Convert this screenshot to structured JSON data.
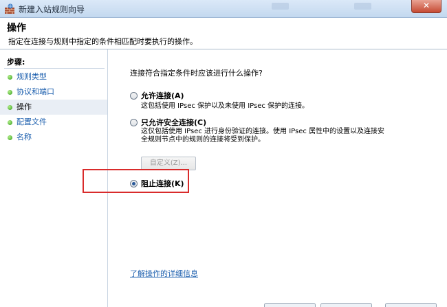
{
  "window": {
    "title": "新建入站规则向导",
    "close_glyph": "✕"
  },
  "header": {
    "title": "操作",
    "description": "指定在连接与规则中指定的条件相匹配时要执行的操作。"
  },
  "sidebar": {
    "steps_label": "步骤:",
    "items": [
      {
        "label": "规则类型",
        "active": false
      },
      {
        "label": "协议和端口",
        "active": false
      },
      {
        "label": "操作",
        "active": true
      },
      {
        "label": "配置文件",
        "active": false
      },
      {
        "label": "名称",
        "active": false
      }
    ]
  },
  "main": {
    "question": "连接符合指定条件时应该进行什么操作?",
    "options": [
      {
        "label": "允许连接(A)",
        "desc": "这包括使用 IPsec 保护以及未使用 IPsec 保护的连接。",
        "checked": false
      },
      {
        "label": "只允许安全连接(C)",
        "desc_line1": "这仅包括使用 IPsec 进行身份验证的连接。使用 IPsec 属性中的设置以及连接安",
        "desc_line2": "全规则节点中的规则的连接将受到保护。",
        "checked": false
      },
      {
        "label": "阻止连接(K)",
        "checked": true
      }
    ],
    "customize_button": "自定义(Z)...",
    "learn_more_link": "了解操作的详细信息"
  },
  "colors": {
    "link": "#1c5fae",
    "highlight": "#d92b2b"
  }
}
